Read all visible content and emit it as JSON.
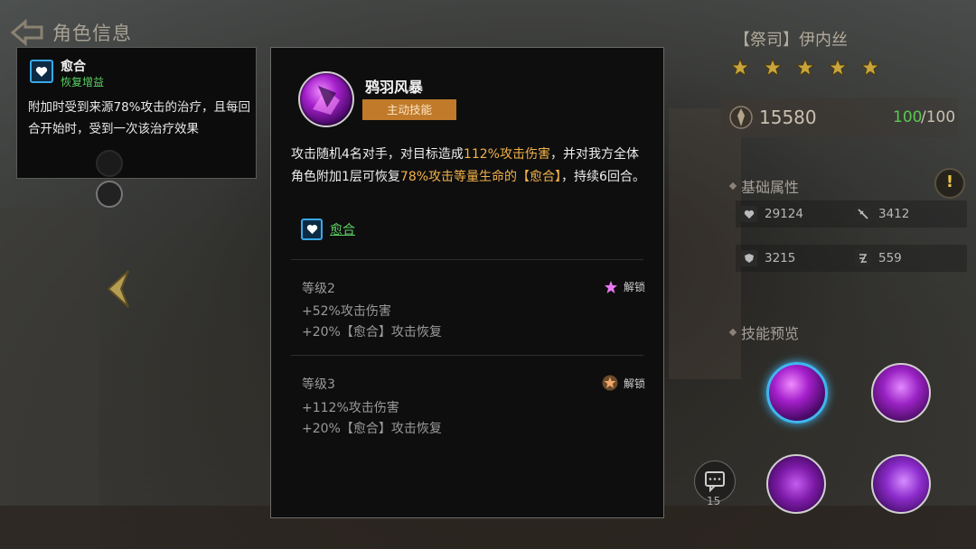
{
  "header": {
    "title": "角色信息"
  },
  "tooltip": {
    "buff_name": "愈合",
    "buff_category": "恢复增益",
    "description": "附加时受到来源78%攻击的治疗，且每回合开始时，受到一次该治疗效果"
  },
  "skill": {
    "name": "鸦羽风暴",
    "type": "主动技能",
    "desc_1": "攻击随机4名对手，对目标造成",
    "desc_hl_1": "112%攻击伤害",
    "desc_2": "，并对我方全体角色附加1层可恢复",
    "desc_hl_2": "78%攻击等量生命的【愈合】",
    "desc_3": "，持续6回合。",
    "buff_link": "愈合",
    "levels": [
      {
        "title": "等级2",
        "lines": [
          "+52%攻击伤害",
          "+20%【愈合】攻击恢复"
        ],
        "lock_label": "解锁",
        "lock_icon": "pink-star-icon"
      },
      {
        "title": "等级3",
        "lines": [
          "+112%攻击伤害",
          "+20%【愈合】攻击恢复"
        ],
        "lock_label": "解锁",
        "lock_icon": "bronze-star-icon"
      }
    ]
  },
  "character": {
    "name": "【祭司】伊内丝",
    "stars": 5,
    "power": "15580",
    "level_current": "100",
    "level_max": "/100"
  },
  "attributes": {
    "title": "基础属性",
    "hp": "29124",
    "attack": "3412",
    "defense": "3215",
    "speed": "559"
  },
  "skill_preview": {
    "title": "技能预览"
  },
  "chat": {
    "count": "15"
  },
  "colors": {
    "highlight": "#f2b24a",
    "buff_green": "#5cd064",
    "selected_ring": "#3fb6ef",
    "tag_orange": "#c07a2a"
  }
}
